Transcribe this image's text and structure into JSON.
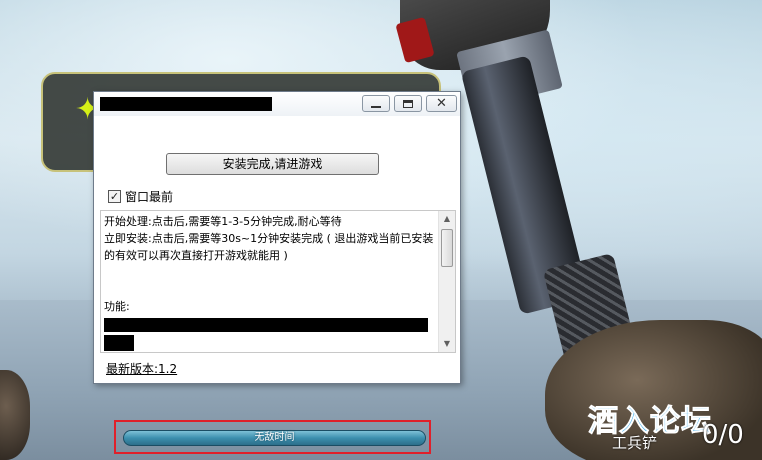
{
  "hud": {
    "invincible_label": "无敌时间",
    "weapon_name": "工兵铲",
    "ammo": "0/0",
    "watermark": "酒入论坛"
  },
  "dialog": {
    "install_button": "安装完成,请进游戏",
    "checkbox_label": "窗口最前",
    "checkbox_checked": true,
    "text_lines": [
      "开始处理:点击后,需要等1-3-5分钟完成,耐心等待",
      "立即安装:点击后,需要等30s~1分钟安装完成 ( 退出游戏当前已安装的有效可以再次直接打开游戏就能用 )"
    ],
    "features_label": "功能:",
    "version_link": "最新版本:1.2"
  },
  "icons": {
    "minimize": "minimize-icon",
    "maximize": "maximize-icon",
    "close": "close-icon",
    "check": "check-icon",
    "scroll_up": "triangle-up-icon",
    "scroll_down": "triangle-down-icon"
  }
}
